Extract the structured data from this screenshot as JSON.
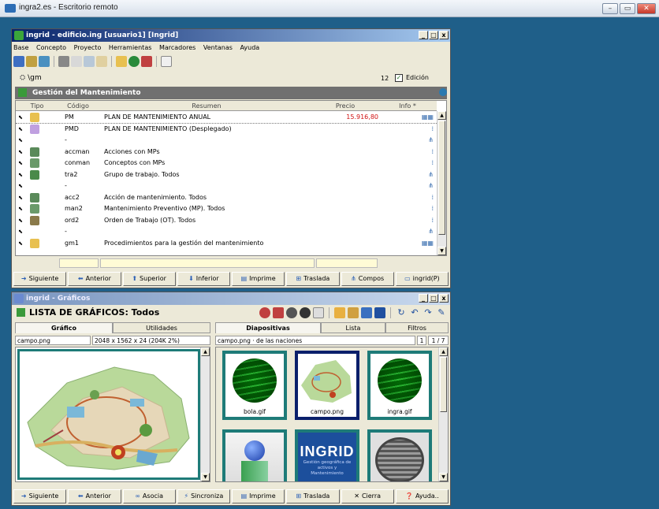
{
  "remote_bar": {
    "title": "ingra2.es - Escritorio remoto"
  },
  "main_window": {
    "title": "ingrid - edificio.ing  [usuario1]  [Ingrid]",
    "menu": [
      "Base",
      "Concepto",
      "Proyecto",
      "Herramientas",
      "Marcadores",
      "Ventanas",
      "Ayuda"
    ],
    "path": "\\gm",
    "count": "12",
    "edicion_label": "Edición",
    "edicion_checked": true,
    "section_title": "Gestión del Mantenimiento",
    "columns": {
      "tipo": "Tipo",
      "codigo": "Código",
      "resumen": "Resumen",
      "precio": "Precio",
      "info": "Info *"
    },
    "rows": [
      {
        "codigo": "PM",
        "resumen": "PLAN DE MANTENIMIENTO ANUAL",
        "precio": "15.916,80",
        "tipo_color": "#e8c050",
        "info_icon": "grid-icon"
      },
      {
        "codigo": "PMD",
        "resumen": "PLAN DE MANTENIMIENTO (Desplegado)",
        "precio": "",
        "tipo_color": "#c0a0e0",
        "info_icon": "dots-icon"
      },
      {
        "codigo": "-",
        "resumen": "",
        "precio": "",
        "tipo_color": "",
        "info_icon": "tree-icon"
      },
      {
        "codigo": "accman",
        "resumen": "Acciones con MPs",
        "precio": "",
        "tipo_color": "#5a8a5a",
        "info_icon": "dots-icon"
      },
      {
        "codigo": "conman",
        "resumen": "Conceptos con MPs",
        "precio": "",
        "tipo_color": "#6a9a6a",
        "info_icon": "dots-icon"
      },
      {
        "codigo": "tra2",
        "resumen": "Grupo de trabajo. Todos",
        "precio": "",
        "tipo_color": "#4a8a4a",
        "info_icon": "tree-icon"
      },
      {
        "codigo": "-",
        "resumen": "",
        "precio": "",
        "tipo_color": "",
        "info_icon": "tree-icon"
      },
      {
        "codigo": "acc2",
        "resumen": "Acción de mantenimiento. Todos",
        "precio": "",
        "tipo_color": "#5a8a5a",
        "info_icon": "dots-icon"
      },
      {
        "codigo": "man2",
        "resumen": "Mantenimiento Preventivo (MP). Todos",
        "precio": "",
        "tipo_color": "#6a9a6a",
        "info_icon": "dots-icon"
      },
      {
        "codigo": "ord2",
        "resumen": "Orden de Trabajo (OT). Todos",
        "precio": "",
        "tipo_color": "#8a7a4a",
        "info_icon": "dots-icon"
      },
      {
        "codigo": "-",
        "resumen": "",
        "precio": "",
        "tipo_color": "",
        "info_icon": "tree-icon"
      },
      {
        "codigo": "gm1",
        "resumen": "Procedimientos para la gestión del mantenimiento",
        "precio": "",
        "tipo_color": "#e8c050",
        "info_icon": "grid-icon"
      }
    ],
    "buttons": [
      "Siguiente",
      "Anterior",
      "Superior",
      "Inferior",
      "Imprime",
      "Traslada",
      "Compos",
      "ingrid(P)"
    ]
  },
  "graphics_window": {
    "title": "ingrid - Gráficos",
    "list_title": "LISTA DE GRÁFICOS: Todos",
    "left_tabs": [
      "Gráfico",
      "Utilidades"
    ],
    "right_tabs": [
      "Diapositivas",
      "Lista",
      "Filtros"
    ],
    "file_name": "campo.png",
    "file_info": "2048 x 1562 x 24 (204K 2%)",
    "slide_info": "campo.png · de las naciones",
    "page_indicator": "1",
    "page_count": "1 / 7",
    "slides": [
      {
        "caption": "bola.gif",
        "kind": "ball"
      },
      {
        "caption": "campo.png",
        "kind": "map"
      },
      {
        "caption": "ingra.gif",
        "kind": "ball"
      },
      {
        "caption": "",
        "kind": "figure"
      },
      {
        "caption": "",
        "kind": "logo",
        "logo_text": "INGRID",
        "logo_sub": "Gestión geográfica de activos y Mantenimiento"
      },
      {
        "caption": "",
        "kind": "manhole"
      }
    ],
    "buttons": [
      "Siguiente",
      "Anterior",
      "Asocia",
      "Sincroniza",
      "Imprime",
      "Traslada",
      "Cierra",
      "Ayuda.."
    ]
  }
}
